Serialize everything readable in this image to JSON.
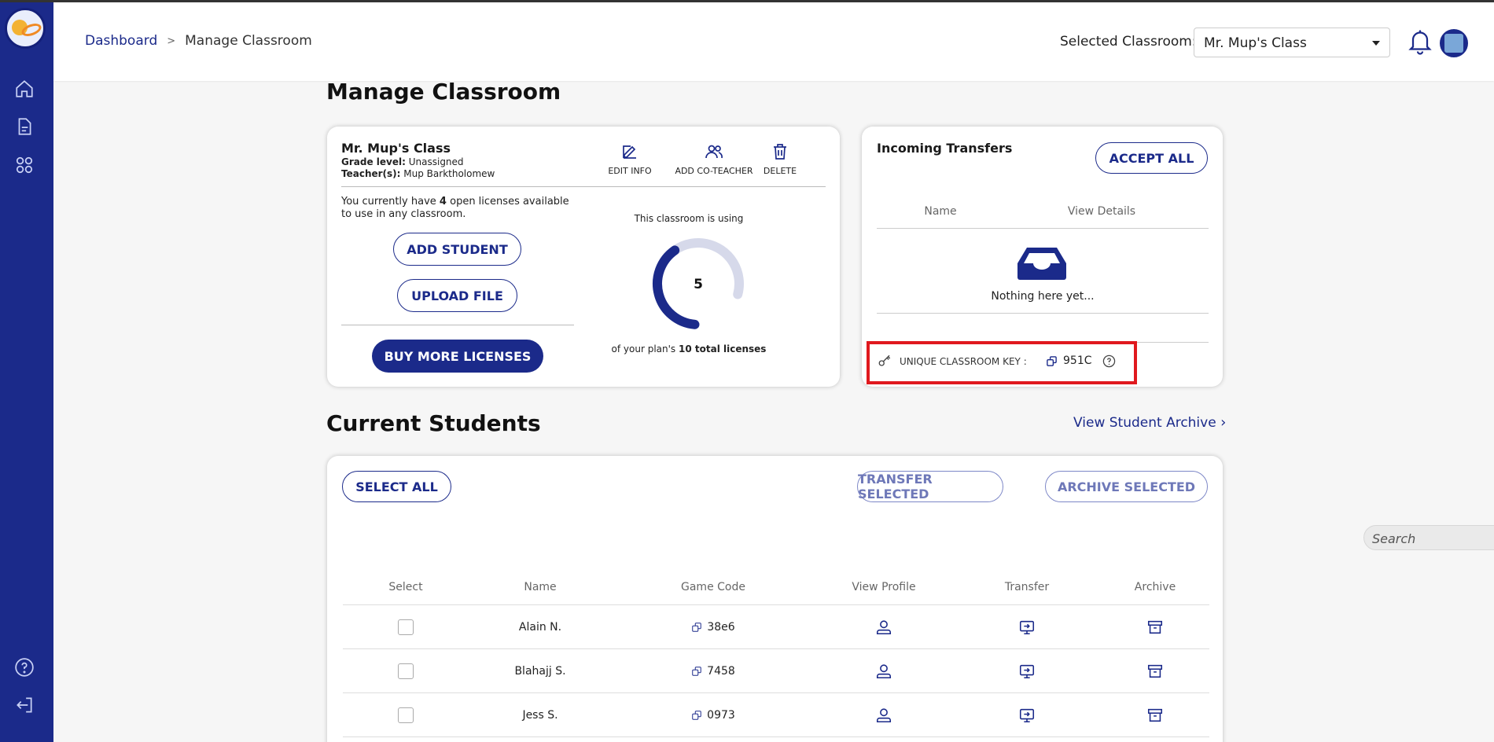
{
  "header": {
    "breadcrumb": {
      "home": "Dashboard",
      "separator": ">",
      "current": "Manage Classroom"
    },
    "selected_classroom_label": "Selected Classroom:",
    "selected_classroom_value": "Mr. Mup's Class"
  },
  "page_title": "Manage Classroom",
  "classroom_card": {
    "name": "Mr. Mup's Class",
    "grade_label": "Grade level:",
    "grade_value": "Unassigned",
    "teachers_label": "Teacher(s):",
    "teachers_value": "Mup Barktholomew",
    "actions": {
      "edit": "EDIT INFO",
      "add_coteacher": "ADD CO-TEACHER",
      "delete": "DELETE"
    },
    "licenses_text_pre": "You currently have",
    "licenses_open": "4",
    "licenses_text_post": "open licenses available to use in any classroom.",
    "add_student": "ADD STUDENT",
    "upload_file": "UPLOAD FILE",
    "buy_more": "BUY MORE LICENSES",
    "usage_label": "This classroom is using",
    "usage_count": "5",
    "usage_fraction": 0.5,
    "plan_text_pre": "of your plan's",
    "plan_total": "10 total licenses"
  },
  "transfers_card": {
    "title": "Incoming Transfers",
    "accept_all": "ACCEPT ALL",
    "columns": [
      "Name",
      "View Details"
    ],
    "empty_text": "Nothing here yet...",
    "key_label": "UNIQUE CLASSROOM KEY :",
    "key_value": "951C"
  },
  "students_section": {
    "title": "Current Students",
    "archive_link": "View Student Archive",
    "select_all": "SELECT ALL",
    "transfer_selected": "TRANSFER SELECTED",
    "archive_selected": "ARCHIVE SELECTED",
    "search_placeholder": "Search",
    "columns": [
      "Select",
      "Name",
      "Game Code",
      "View Profile",
      "Transfer",
      "Archive"
    ],
    "rows": [
      {
        "name": "Alain N.",
        "code": "38e6"
      },
      {
        "name": "Blahajj S.",
        "code": "7458"
      },
      {
        "name": "Jess S.",
        "code": "0973"
      }
    ]
  },
  "colors": {
    "brand": "#1b2a8a",
    "highlight": "#e0191e",
    "gauge_track": "#d6d9ea"
  }
}
